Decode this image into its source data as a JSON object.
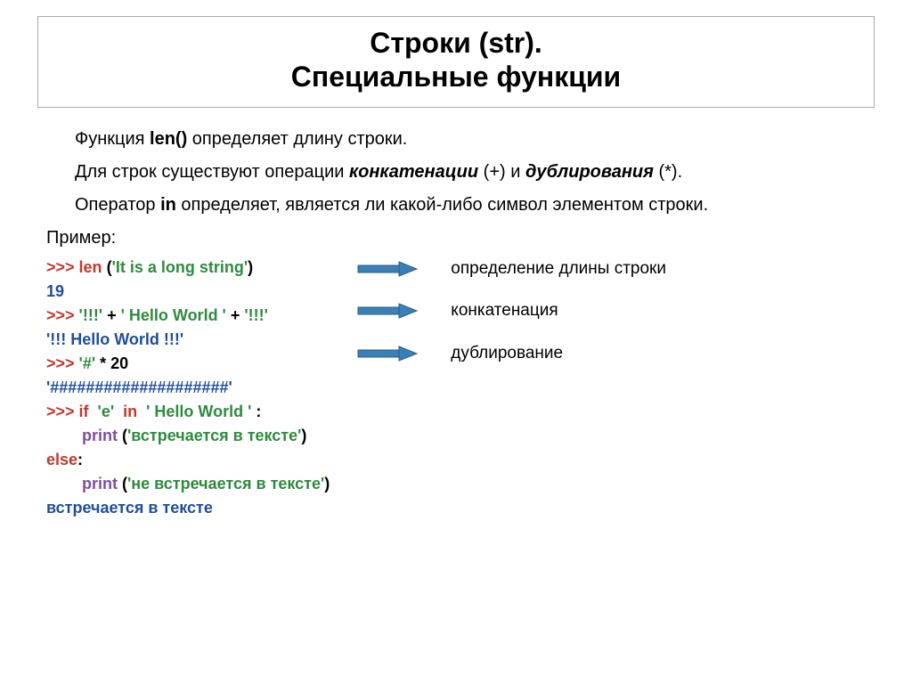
{
  "title_line1": "Строки (str).",
  "title_line2": "Специальные функции",
  "p1_a": "Функция ",
  "p1_b": "len()",
  "p1_c": " определяет длину строки.",
  "p2_a": "Для строк существуют операции ",
  "p2_b": "конкатенации",
  "p2_c": " (+) и ",
  "p2_d": "дублирования",
  "p2_e": " (*).",
  "p3_a": "Оператор ",
  "p3_b": "in",
  "p3_c": " определяет, является ли какой-либо символ элементом строки.",
  "example_label": "Пример:",
  "code": {
    "l1_prompt": ">>> ",
    "l1_func": "len ",
    "l1_open": "(",
    "l1_str": "'It is a long string'",
    "l1_close": ")",
    "l2_val": "19",
    "l3_prompt": ">>> ",
    "l3_s1": "'!!!'",
    "l3_op1": " + ",
    "l3_s2": "' Hello World '",
    "l3_op2": " + ",
    "l3_s3": "'!!!'",
    "l4_val": "'!!! Hello World !!!'",
    "l5_prompt": ">>> ",
    "l5_s1": "'#'",
    "l5_op": " * 20",
    "l6_val": "'####################'",
    "l7_prompt": ">>> ",
    "l7_if": "if  ",
    "l7_s1": "'e'",
    "l7_in": "  in  ",
    "l7_s2": "' Hello World '",
    "l7_colon": " :",
    "l8_indent": "        ",
    "l8_print": "print ",
    "l8_open": "(",
    "l8_str": "'встречается в тексте'",
    "l8_close": ")",
    "l9_else": "else",
    "l9_colon": ":",
    "l10_indent": "        ",
    "l10_print": "print ",
    "l10_open": "(",
    "l10_str": "'не встречается в тексте'",
    "l10_close": ")",
    "l11_val": "встречается в тексте"
  },
  "notes": {
    "n1": "определение длины строки",
    "n2": "конкатенация",
    "n3": "дублирование"
  },
  "colors": {
    "arrow_fill": "#3a7fb5",
    "arrow_stroke": "#2a5f8a"
  }
}
